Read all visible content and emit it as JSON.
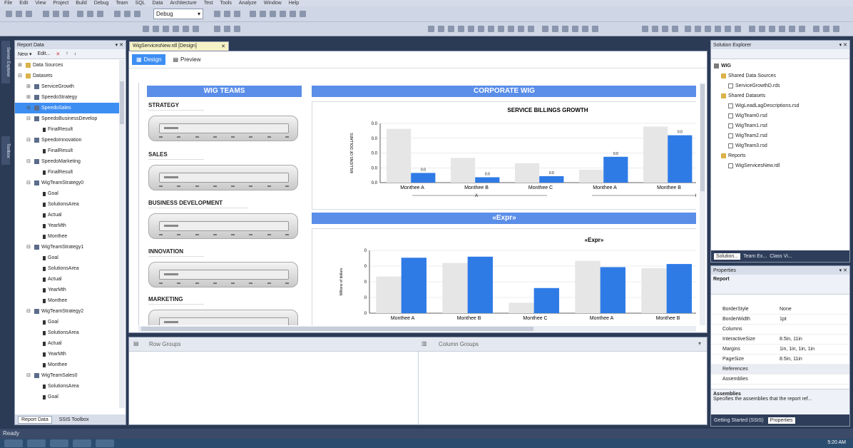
{
  "menu": [
    "File",
    "Edit",
    "View",
    "Project",
    "Build",
    "Debug",
    "Team",
    "SQL",
    "Data",
    "Architecture",
    "Test",
    "Tools",
    "Analyze",
    "Window",
    "Help"
  ],
  "toolbar": {
    "debug_value": "Debug"
  },
  "left_strip_tabs": [
    "Server Explorer",
    "Toolbox"
  ],
  "report_data": {
    "title": "Report Data",
    "new_label": "New ▾",
    "edit_label": "Edit...",
    "tree": [
      {
        "label": "Data Sources",
        "type": "folder",
        "indent": 1,
        "exp": "⊞"
      },
      {
        "label": "Datasets",
        "type": "folder",
        "indent": 1,
        "exp": "⊟"
      },
      {
        "label": "ServiceGrowth",
        "type": "ds",
        "indent": 2,
        "exp": "⊞"
      },
      {
        "label": "SpeedoStrategy",
        "type": "ds",
        "indent": 2,
        "exp": "⊞"
      },
      {
        "label": "SpeedoSales",
        "type": "ds",
        "indent": 2,
        "exp": "⊞",
        "selected": true
      },
      {
        "label": "SpeedoBusinessDevelop",
        "type": "ds",
        "indent": 2,
        "exp": "⊟"
      },
      {
        "label": "FinalResult",
        "type": "field",
        "indent": 3,
        "exp": ""
      },
      {
        "label": "SpeedoInnovation",
        "type": "ds",
        "indent": 2,
        "exp": "⊟"
      },
      {
        "label": "FinalResult",
        "type": "field",
        "indent": 3,
        "exp": ""
      },
      {
        "label": "SpeedoMarketing",
        "type": "ds",
        "indent": 2,
        "exp": "⊟"
      },
      {
        "label": "FinalResult",
        "type": "field",
        "indent": 3,
        "exp": ""
      },
      {
        "label": "WigTeamStrategy0",
        "type": "ds",
        "indent": 2,
        "exp": "⊟"
      },
      {
        "label": "Goal",
        "type": "field",
        "indent": 3,
        "exp": ""
      },
      {
        "label": "SolutionsArea",
        "type": "field",
        "indent": 3,
        "exp": ""
      },
      {
        "label": "Actual",
        "type": "field",
        "indent": 3,
        "exp": ""
      },
      {
        "label": "YearMth",
        "type": "field",
        "indent": 3,
        "exp": ""
      },
      {
        "label": "Monthee",
        "type": "field",
        "indent": 3,
        "exp": ""
      },
      {
        "label": "WigTeamStrategy1",
        "type": "ds",
        "indent": 2,
        "exp": "⊟"
      },
      {
        "label": "Goal",
        "type": "field",
        "indent": 3,
        "exp": ""
      },
      {
        "label": "SolutionsArea",
        "type": "field",
        "indent": 3,
        "exp": ""
      },
      {
        "label": "Actual",
        "type": "field",
        "indent": 3,
        "exp": ""
      },
      {
        "label": "YearMth",
        "type": "field",
        "indent": 3,
        "exp": ""
      },
      {
        "label": "Monthee",
        "type": "field",
        "indent": 3,
        "exp": ""
      },
      {
        "label": "WigTeamStrategy2",
        "type": "ds",
        "indent": 2,
        "exp": "⊟"
      },
      {
        "label": "Goal",
        "type": "field",
        "indent": 3,
        "exp": ""
      },
      {
        "label": "SolutionsArea",
        "type": "field",
        "indent": 3,
        "exp": ""
      },
      {
        "label": "Actual",
        "type": "field",
        "indent": 3,
        "exp": ""
      },
      {
        "label": "YearMth",
        "type": "field",
        "indent": 3,
        "exp": ""
      },
      {
        "label": "Monthee",
        "type": "field",
        "indent": 3,
        "exp": ""
      },
      {
        "label": "WigTeamSales0",
        "type": "ds",
        "indent": 2,
        "exp": "⊟"
      },
      {
        "label": "SolutionsArea",
        "type": "field",
        "indent": 3,
        "exp": ""
      },
      {
        "label": "Goal",
        "type": "field",
        "indent": 3,
        "exp": ""
      }
    ],
    "bottom_tabs": [
      "Report Data",
      "SSIS Toolbox"
    ]
  },
  "document": {
    "tab_label": "WigServicesNew.rdl [Design]",
    "design_label": "Design",
    "preview_label": "Preview",
    "left_header": "WIG TEAMS",
    "sections": [
      "STRATEGY",
      "SALES",
      "BUSINESS DEVELOPMENT",
      "INNOVATION",
      "MARKETING"
    ],
    "corp_header": "CORPORATE WIG",
    "expr_header": "«Expr»",
    "row_groups": "Row Groups",
    "column_groups": "Column Groups"
  },
  "chart_data": [
    {
      "type": "bar",
      "title": "SERVICE BILLINGS GROWTH",
      "ylabel": "MILLIONS OF DOLLARS",
      "ytick_labels": [
        "0.0",
        "0.0",
        "0.0",
        "0.0",
        "0.0"
      ],
      "categories": [
        "Monthee A",
        "Monthee B",
        "Monthee C",
        "Monthee A",
        "Monthee B"
      ],
      "series": [
        {
          "values": [
            5.0,
            2.3,
            1.8,
            1.2,
            5.2
          ]
        },
        {
          "values": [
            0.9,
            0.5,
            0.6,
            2.4,
            4.4
          ],
          "data_labels": [
            "0.0",
            "0.0",
            "0.0",
            "0.0",
            "0.0"
          ]
        }
      ],
      "ylim": [
        0,
        5.5
      ],
      "group_labels": [
        "A",
        "B"
      ],
      "colors": [
        "#e6e6e6",
        "#2f7be6"
      ]
    },
    {
      "type": "bar",
      "title": "«Expr»",
      "ylabel": "Millions of dollars",
      "ytick_labels": [
        "0",
        "0",
        "0",
        "0",
        "0"
      ],
      "categories": [
        "Monthee A",
        "Monthee B",
        "Monthee C",
        "Monthee A",
        "Monthee B"
      ],
      "series": [
        {
          "values": [
            3.5,
            4.8,
            1.0,
            5.0,
            4.3
          ]
        },
        {
          "values": [
            5.3,
            5.4,
            2.4,
            4.4,
            4.7
          ]
        }
      ],
      "ylim": [
        0,
        6
      ],
      "colors": [
        "#e6e6e6",
        "#2f7be6"
      ]
    }
  ],
  "solution_explorer": {
    "title": "Solution Explorer",
    "tree": [
      {
        "label": "WIG",
        "indent": 0,
        "type": "proj"
      },
      {
        "label": "Shared Data Sources",
        "indent": 1,
        "type": "folder"
      },
      {
        "label": "ServiceGrowthD.rds",
        "indent": 2,
        "type": "file"
      },
      {
        "label": "Shared Datasets",
        "indent": 1,
        "type": "folder"
      },
      {
        "label": "WigLeadLagDescriptions.rsd",
        "indent": 2,
        "type": "file"
      },
      {
        "label": "WigTeam0.rsd",
        "indent": 2,
        "type": "file"
      },
      {
        "label": "WigTeam1.rsd",
        "indent": 2,
        "type": "file"
      },
      {
        "label": "WigTeam2.rsd",
        "indent": 2,
        "type": "file"
      },
      {
        "label": "WigTeam3.rsd",
        "indent": 2,
        "type": "file"
      },
      {
        "label": "Reports",
        "indent": 1,
        "type": "folder"
      },
      {
        "label": "WigServicesNew.rdl",
        "indent": 2,
        "type": "file"
      }
    ],
    "tabs": [
      "Solution...",
      "Team Ex...",
      "Class Vi..."
    ]
  },
  "properties": {
    "title": "Properties",
    "object": "Report",
    "rows": [
      {
        "k": "BorderStyle",
        "v": "None"
      },
      {
        "k": "BorderWidth",
        "v": "1pt"
      },
      {
        "k": "Columns",
        "v": ""
      },
      {
        "k": "InteractiveSize",
        "v": "8.5in, 11in"
      },
      {
        "k": "Margins",
        "v": "1in, 1in, 1in, 1in"
      },
      {
        "k": "PageSize",
        "v": "8.5in, 11in"
      },
      {
        "k": "References",
        "v": ""
      },
      {
        "k": "Assemblies",
        "v": ""
      }
    ],
    "desc_title": "Assemblies",
    "desc_text": "Specifies the assemblies that the report ref...",
    "tabs": [
      "Getting Started (SSIS)",
      "Properties"
    ]
  },
  "status": {
    "text": "Ready"
  },
  "clock": "5:20 AM"
}
